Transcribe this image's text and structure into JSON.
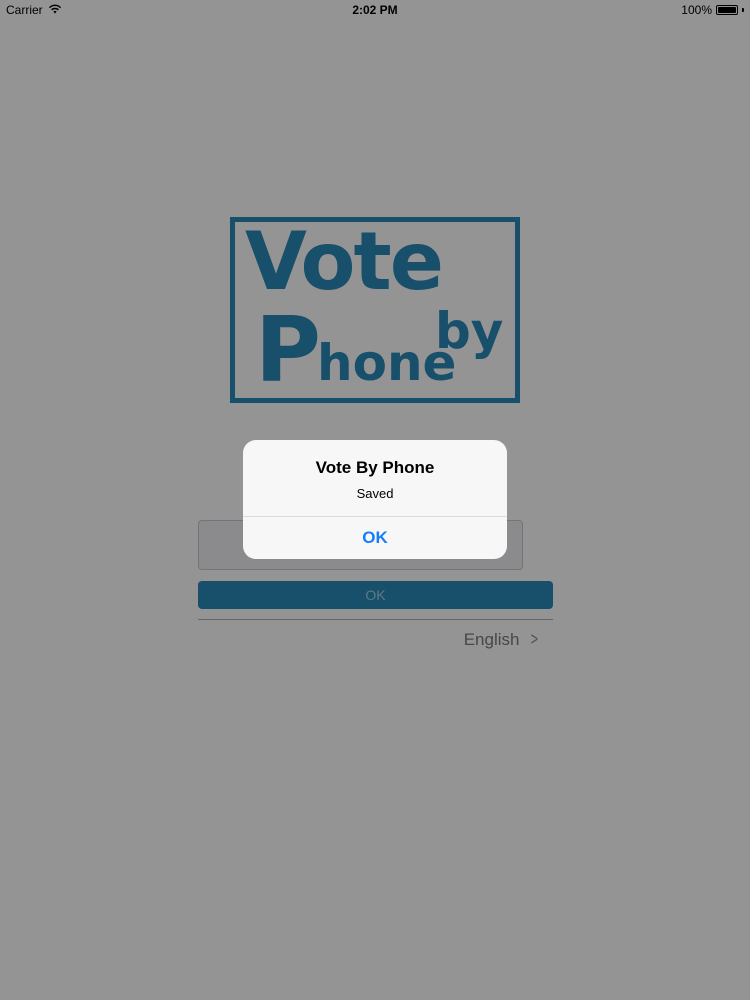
{
  "status_bar": {
    "carrier": "Carrier",
    "time": "2:02 PM",
    "battery": "100%",
    "battery_level": 1.0
  },
  "logo": {
    "vote": "Vote",
    "by": "by",
    "p": "P",
    "hone": "hone",
    "color": "#2a8ab8"
  },
  "form": {
    "ok_label": "OK",
    "language": "English",
    "accent": "#2a8ab8"
  },
  "alert": {
    "title": "Vote By Phone",
    "message": "Saved",
    "button_label": "OK",
    "button_color": "#147efb"
  },
  "icons": {
    "wifi": "wifi-icon",
    "battery": "battery-icon",
    "chevron": "chevron-right-icon"
  }
}
